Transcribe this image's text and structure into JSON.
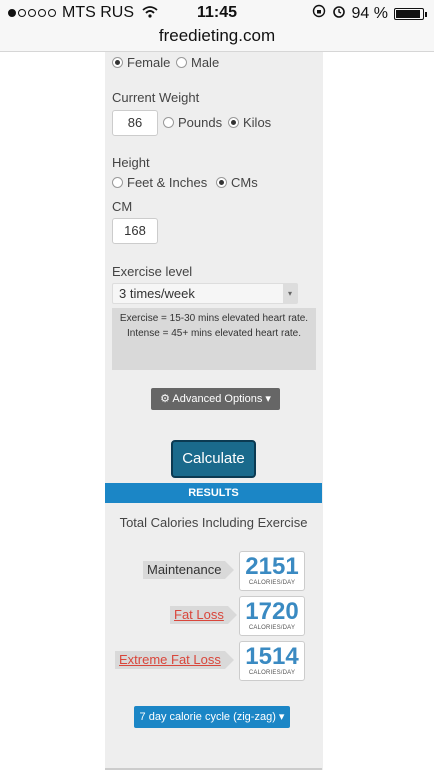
{
  "status_bar": {
    "carrier": "MTS RUS",
    "time": "11:45",
    "battery": "94 %",
    "signal_bars_filled": 1,
    "signal_bars_total": 5,
    "icons": [
      "wifi-icon",
      "rotation-lock-icon",
      "alarm-icon",
      "battery-icon"
    ]
  },
  "browser": {
    "url": "freedieting.com"
  },
  "form": {
    "gender": {
      "options": [
        "Female",
        "Male"
      ],
      "selected": "Female"
    },
    "current_weight": {
      "label": "Current Weight",
      "value": "86",
      "units": [
        "Pounds",
        "Kilos"
      ],
      "selected_unit": "Kilos"
    },
    "height": {
      "label": "Height",
      "units": [
        "Feet & Inches",
        "CMs"
      ],
      "selected_unit": "CMs",
      "cm_label": "CM",
      "cm_value": "168"
    },
    "exercise": {
      "label": "Exercise level",
      "selected": "3 times/week",
      "note_line1": "Exercise = 15-30 mins elevated heart rate.",
      "note_line2": "Intense = 45+ mins elevated heart rate."
    },
    "advanced_button": "Advanced Options ▾",
    "calculate_button": "Calculate"
  },
  "results": {
    "header": "RESULTS",
    "subtitle": "Total Calories Including Exercise",
    "rows": [
      {
        "label": "Maintenance",
        "value": "2151",
        "unit": "CALORIES/DAY"
      },
      {
        "label": "Fat Loss",
        "value": "1720",
        "unit": "CALORIES/DAY"
      },
      {
        "label": "Extreme Fat Loss",
        "value": "1514",
        "unit": "CALORIES/DAY"
      }
    ],
    "zigzag_button": "7 day calorie cycle (zig-zag) ▾"
  },
  "colors": {
    "accent": "#1b86c6",
    "calculate": "#1a6a8c",
    "value_text": "#3a8ac2",
    "link_red": "#d9463b"
  }
}
